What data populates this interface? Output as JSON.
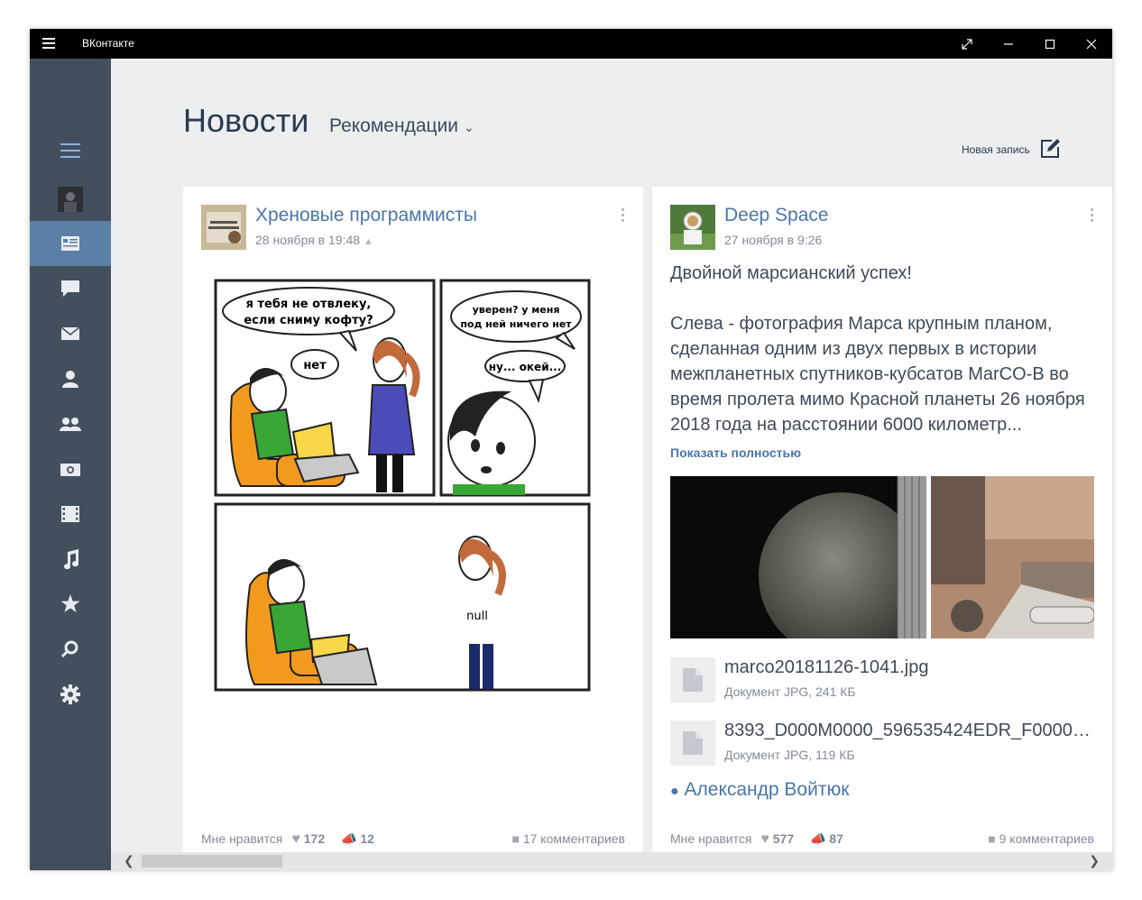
{
  "window": {
    "title": "ВКонтакте"
  },
  "header": {
    "page_title": "Новости",
    "filter_label": "Рекомендации",
    "new_post_label": "Новая запись"
  },
  "posts": [
    {
      "author": "Хреновые программисты",
      "date": "28 ноября в 19:48",
      "comic": {
        "bubble1": "я тебя не отвлеку, если сниму кофту?",
        "bubble2": "нет",
        "bubble3": "уверен? у меня под ней ничего нет",
        "bubble4": "ну... окей...",
        "shirt_text": "null"
      },
      "footer": {
        "like_label": "Мне нравится",
        "likes": "172",
        "reposts": "12",
        "comments": "17 комментариев"
      }
    },
    {
      "author": "Deep Space",
      "date": "27 ноября в 9:26",
      "text_title": "Двойной марсианский успех!",
      "text_body": "Слева - фотография Марса крупным планом, сделанная одним из двух первых в истории межпланетных спутников-кубсатов MarCO-B во время пролета мимо Красной планеты 26 ноября 2018 года на расстоянии 6000 километр...",
      "show_more": "Показать полностью",
      "documents": [
        {
          "name": "marco20181126-1041.jpg",
          "meta": "Документ JPG, 241 КБ"
        },
        {
          "name": "8393_D000M0000_596535424EDR_F0000_...",
          "meta": "Документ JPG, 119 КБ"
        }
      ],
      "signer": "Александр Войтюк",
      "footer": {
        "like_label": "Мне нравится",
        "likes": "577",
        "reposts": "87",
        "comments": "9 комментариев"
      }
    }
  ],
  "colors": {
    "sidebar": "#444f5e",
    "sidebar_active": "#5b7fa6",
    "link": "#4a76a8",
    "background": "#edeef0"
  }
}
